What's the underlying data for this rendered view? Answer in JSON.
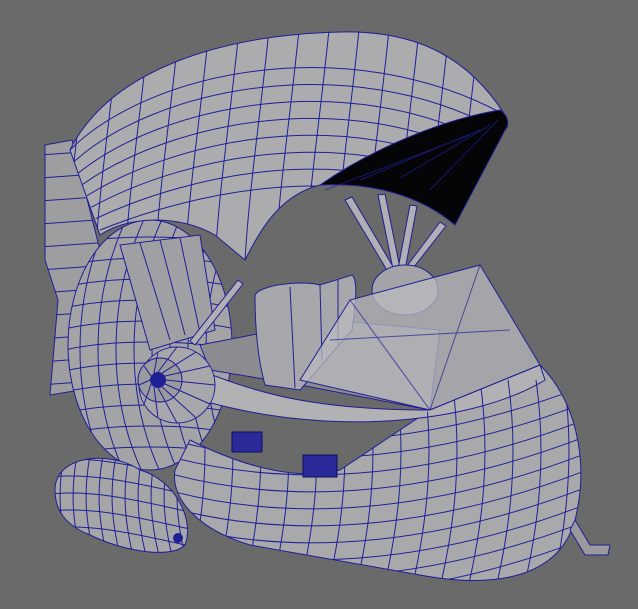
{
  "viewport": {
    "background_color": "#6a6a6a",
    "surface_color": "#a9a9ab",
    "wire_color": "#1f1f96",
    "shadow_color": "#000000"
  }
}
